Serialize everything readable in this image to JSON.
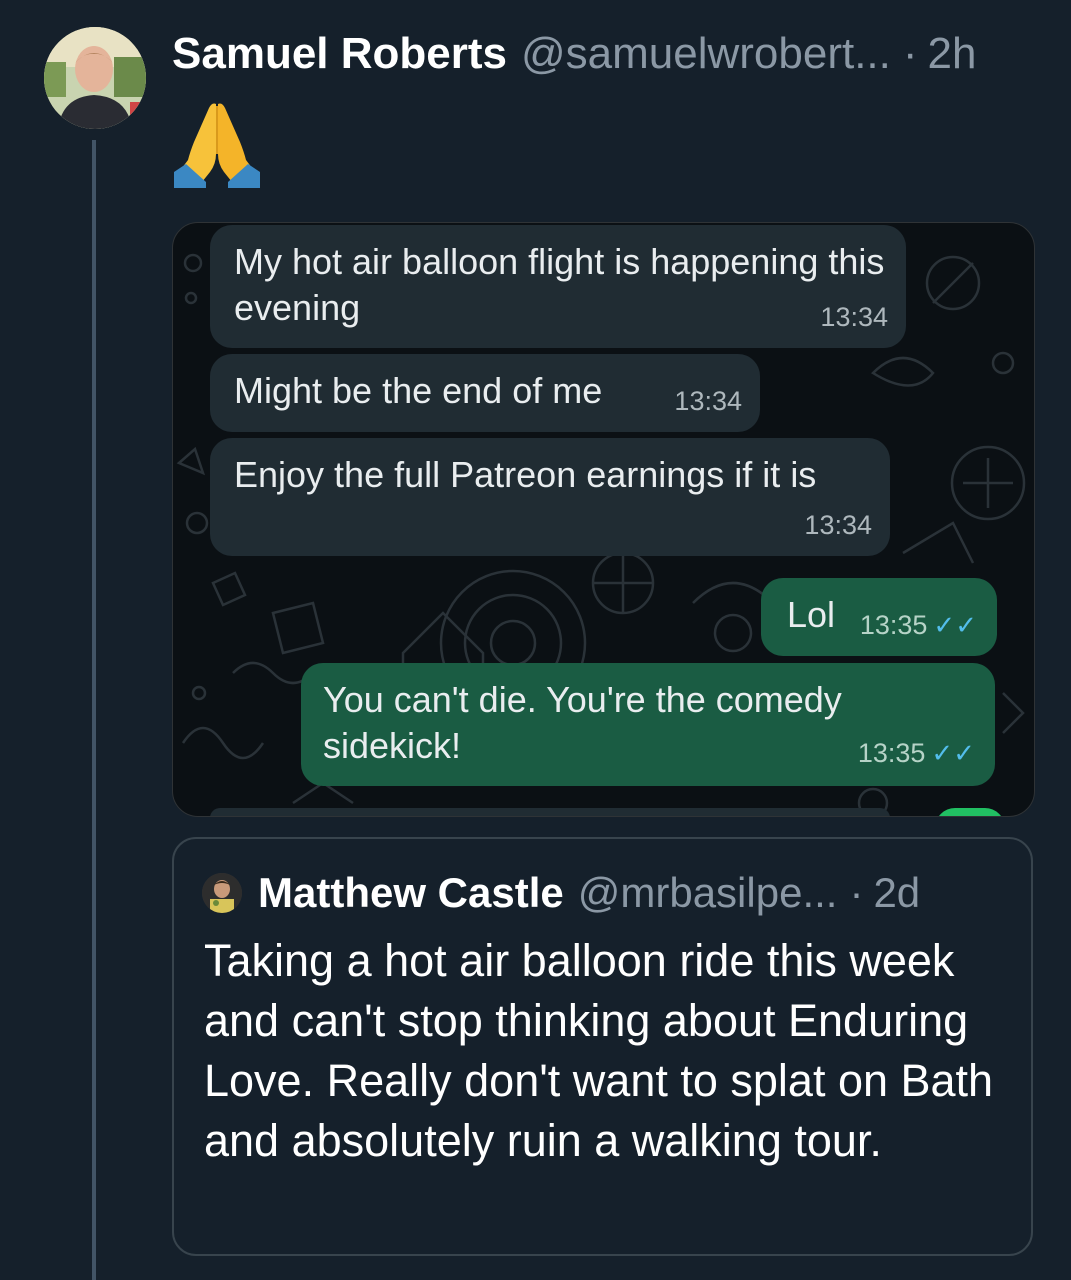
{
  "tweet": {
    "author_name": "Samuel Roberts",
    "author_handle": "@samuelwrobert...",
    "separator": "·",
    "time": "2h",
    "emoji_name": "folded-hands-icon"
  },
  "chat": {
    "messages": [
      {
        "direction": "incoming",
        "text": "My hot air balloon flight is happening this evening",
        "time": "13:34"
      },
      {
        "direction": "incoming",
        "text": "Might be the end of me",
        "time": "13:34"
      },
      {
        "direction": "incoming",
        "text": "Enjoy the full Patreon earnings if it is",
        "time": "13:34"
      },
      {
        "direction": "outgoing",
        "text": "Lol",
        "time": "13:35",
        "status": "✓✓"
      },
      {
        "direction": "outgoing",
        "text": "You can't die. You're the comedy sidekick!",
        "time": "13:35",
        "status": "✓✓"
      }
    ],
    "colors": {
      "incoming": "#202c33",
      "outgoing": "#1a5c43",
      "read_ticks": "#53bdeb"
    }
  },
  "quoted_tweet": {
    "author_name": "Matthew Castle",
    "author_handle": "@mrbasilpe...",
    "separator": "·",
    "time": "2d",
    "text": "Taking a hot air balloon ride this week and can't stop thinking about Enduring Love. Really don't want to splat on Bath and absolutely ruin a walking tour."
  }
}
